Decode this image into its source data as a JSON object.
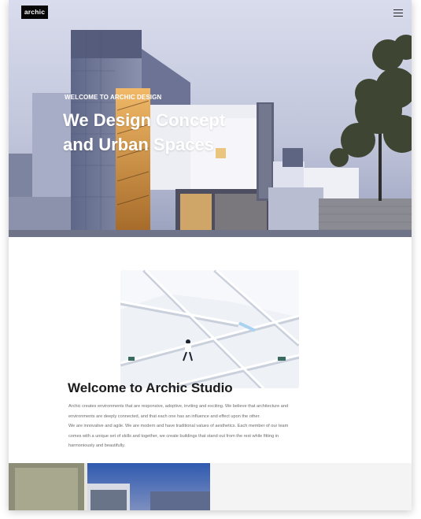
{
  "brand": {
    "logo_text": "archic"
  },
  "nav": {
    "menu_icon": "hamburger-menu-icon"
  },
  "hero": {
    "eyebrow": "WELCOME TO ARCHIC DESIGN",
    "headline_line1": "We Design Concept",
    "headline_line2": "and Urban Spaces",
    "slides_total": 2,
    "active_slide": 1
  },
  "about": {
    "title": "Welcome to Archic Studio",
    "paragraph1": "Archic creates environments that are responsive, adoptive, inviting and exciting. We believe that architecture and environments are deeply connected, and that each one has an influence and effect upon the other.",
    "paragraph2": "We are innovative and agile. We are modern and have traditional values of aesthetics. Each member of our team comes with a unique set of skills and together, we create buildings that stand out from the rest while fitting in harmoniously and beautifully."
  },
  "colors": {
    "logo_bg": "#050505",
    "hero_sky": "#bfc6dc",
    "text_dark": "#1b1b1b",
    "text_body": "#6b6b6b",
    "panel_bg": "#f4f4f4"
  }
}
